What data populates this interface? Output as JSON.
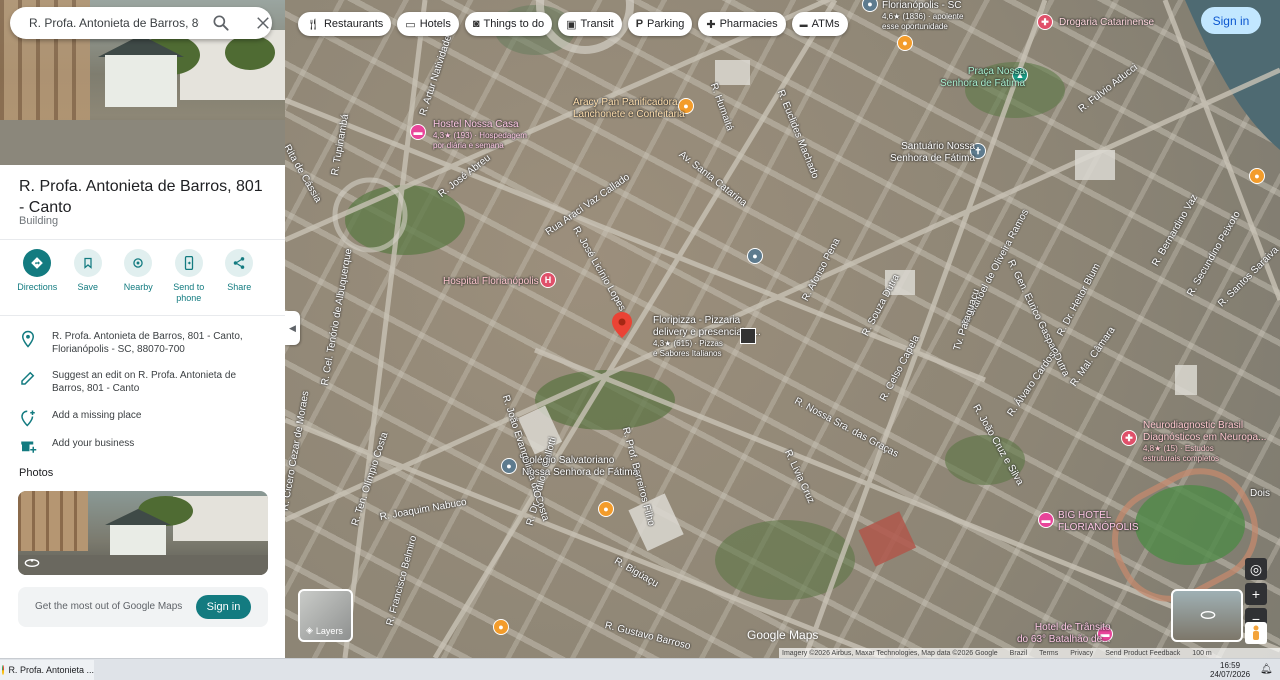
{
  "search": {
    "value": "R. Profa. Antonieta de Barros, 801 - "
  },
  "place": {
    "title": "R. Profa. Antonieta de Barros, 801 - Canto",
    "type": "Building"
  },
  "actions": [
    {
      "label": "Directions",
      "icon": "directions-icon"
    },
    {
      "label": "Save",
      "icon": "bookmark-icon"
    },
    {
      "label": "Nearby",
      "icon": "nearby-icon"
    },
    {
      "label": "Send to phone",
      "icon": "send-to-phone-icon"
    },
    {
      "label": "Share",
      "icon": "share-icon"
    }
  ],
  "info": {
    "address": "R. Profa. Antonieta de Barros, 801 - Canto, Florianópolis - SC, 88070-700",
    "suggest_edit": "Suggest an edit on R. Profa. Antonieta de Barros, 801 - Canto",
    "add_place": "Add a missing place",
    "add_business": "Add your business"
  },
  "photos": {
    "heading": "Photos"
  },
  "promo": {
    "text": "Get the most out of Google Maps",
    "button": "Sign in"
  },
  "chips": [
    {
      "label": "Restaurants",
      "icon": "fork-knife-icon"
    },
    {
      "label": "Hotels",
      "icon": "bed-icon"
    },
    {
      "label": "Things to do",
      "icon": "camera-icon"
    },
    {
      "label": "Transit",
      "icon": "train-icon"
    },
    {
      "label": "Parking",
      "icon": "parking-icon"
    },
    {
      "label": "Pharmacies",
      "icon": "pharmacy-icon"
    },
    {
      "label": "ATMs",
      "icon": "atm-icon"
    }
  ],
  "top_signin": "Sign in",
  "map": {
    "pois": {
      "florianopolis_sc": {
        "name": "Florianópolis - SC",
        "sub1": "4,6★ (1836) · apoiente",
        "sub2": "esse oportunidade"
      },
      "drogaria": {
        "name": "Drogaria Catarinense"
      },
      "praca": {
        "name": "Praça Nossa",
        "name2": "Senhora de Fátima"
      },
      "aracy": {
        "name": "Aracy Pan Panificadora",
        "name2": "Lanchonete e Confeitaria"
      },
      "hostel": {
        "name": "Hostel Nossa Casa",
        "sub1": "4,3★ (193) · Hospedagem",
        "sub2": "por diária e semana"
      },
      "santuario": {
        "name": "Santuário Nossa",
        "name2": "Senhora de Fátima"
      },
      "hospital": {
        "name": "Hospital Florianópolis"
      },
      "floripizza": {
        "name": "Floripizza - Pizzaria",
        "name2": "delivery e presencial n...",
        "sub1": "4,3★ (615) · Pizzas",
        "sub2": "e Sabores Italianos"
      },
      "colegio": {
        "name": "Colégio Salvatoriano",
        "name2": "Nossa Senhora de Fátima"
      },
      "neuro": {
        "name": "Neurodiagnostic Brasil",
        "name2": "Diagnósticos em Neuropa...",
        "sub1": "4,8★ (15) · Estudos",
        "sub2": "estruturais completos"
      },
      "bighotel": {
        "name": "BIG HOTEL",
        "name2": "FLORIANÓPOLIS"
      },
      "hoteltransito": {
        "name": "Hotel de Trânsito",
        "name2": "do 63° Batalhão de..."
      },
      "dois": {
        "name": "Dois"
      }
    },
    "streets": [
      "Rita de Cássia",
      "R. José Abreu",
      "R. Tupinambá",
      "R. Artur Natividade",
      "Rua Arací Vaz Callado",
      "R. José Licínio Lopes",
      "Av. Santa Catarina",
      "R. Humaitá",
      "R. Euclides Machado",
      "R. Afonso Pena",
      "R. Souza Dutra",
      "R. Manoel de Oliveira Ramos",
      "R. Gen. Eurico Gaspar Dutra",
      "R. Dr. Heitor Blum",
      "R. Cel. Tenório de Albuquerque",
      "R. João Evangelista da Costa",
      "R. Nossa Sra. das Graças",
      "R. Lívia Cruz",
      "R. Celso Capela",
      "R. Mal. Câmara",
      "R. Álvaro Cardoso",
      "R. João Cruz e Silva",
      "R. Joaquim Nabuco",
      "R. Prof. Barreiros Filho",
      "R. Bigúaçu",
      "R. Gustavo Barroso",
      "R. Dr. Odilon Gallotti",
      "R. Fulvio Aducci",
      "R. Bernardino Vaz",
      "R. Secundino Peixoto",
      "R. Santos Saraiva",
      "R. Cicero Cezar de Moraes",
      "R. Ten. Olímpio Costa",
      "Tv. Paraguaçu",
      "R. Francisco Belmiro"
    ],
    "brand": "Google Maps",
    "attribution": [
      "Imagery ©2026 Airbus, Maxar Technologies, Map data ©2026 Google",
      "Brazil",
      "Terms",
      "Privacy",
      "Send Product Feedback",
      "100 m"
    ]
  },
  "controls": {
    "layers": "Layers",
    "zoom_in": "+",
    "zoom_out": "−"
  },
  "taskbar": {
    "item": "R. Profa. Antonieta ...",
    "time": "16:59",
    "date": "24/07/2026"
  },
  "colors": {
    "accent": "#137b80",
    "signin_bg": "#c2e7ff",
    "signin_fg": "#0b57d0"
  }
}
